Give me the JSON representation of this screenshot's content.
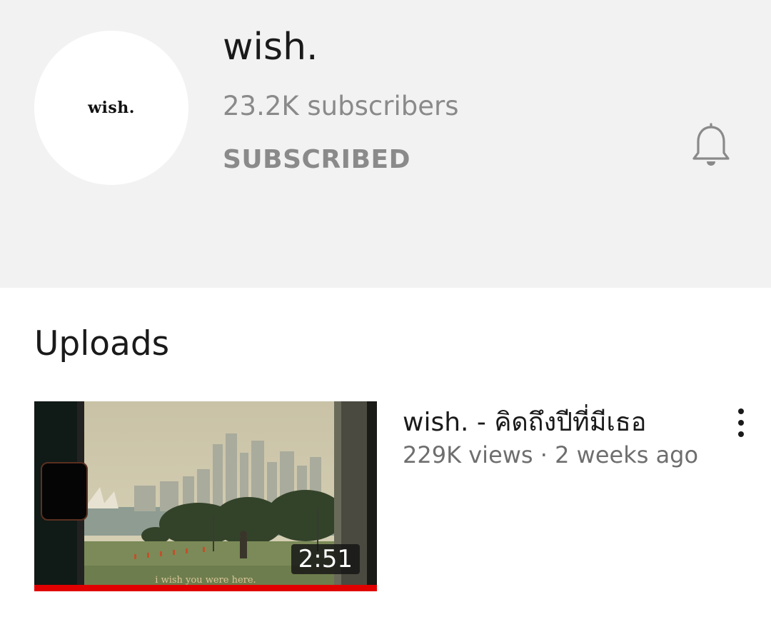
{
  "channel": {
    "avatar_text": "wish.",
    "name": "wish.",
    "subscribers": "23.2K subscribers",
    "subscribe_state": "SUBSCRIBED",
    "notification_icon": "bell-icon"
  },
  "uploads": {
    "title": "Uploads",
    "videos": [
      {
        "title": "wish. - คิดถึงปีที่มีเธอ",
        "meta": "229K views · 2 weeks ago",
        "duration": "2:51",
        "caption": "i wish you were here.",
        "watched_fraction": 1.0,
        "menu_icon": "more-vert-icon"
      }
    ]
  },
  "colors": {
    "header_bg": "#f2f2f2",
    "progress": "#e00000",
    "secondary_text": "#8a8a8a"
  }
}
